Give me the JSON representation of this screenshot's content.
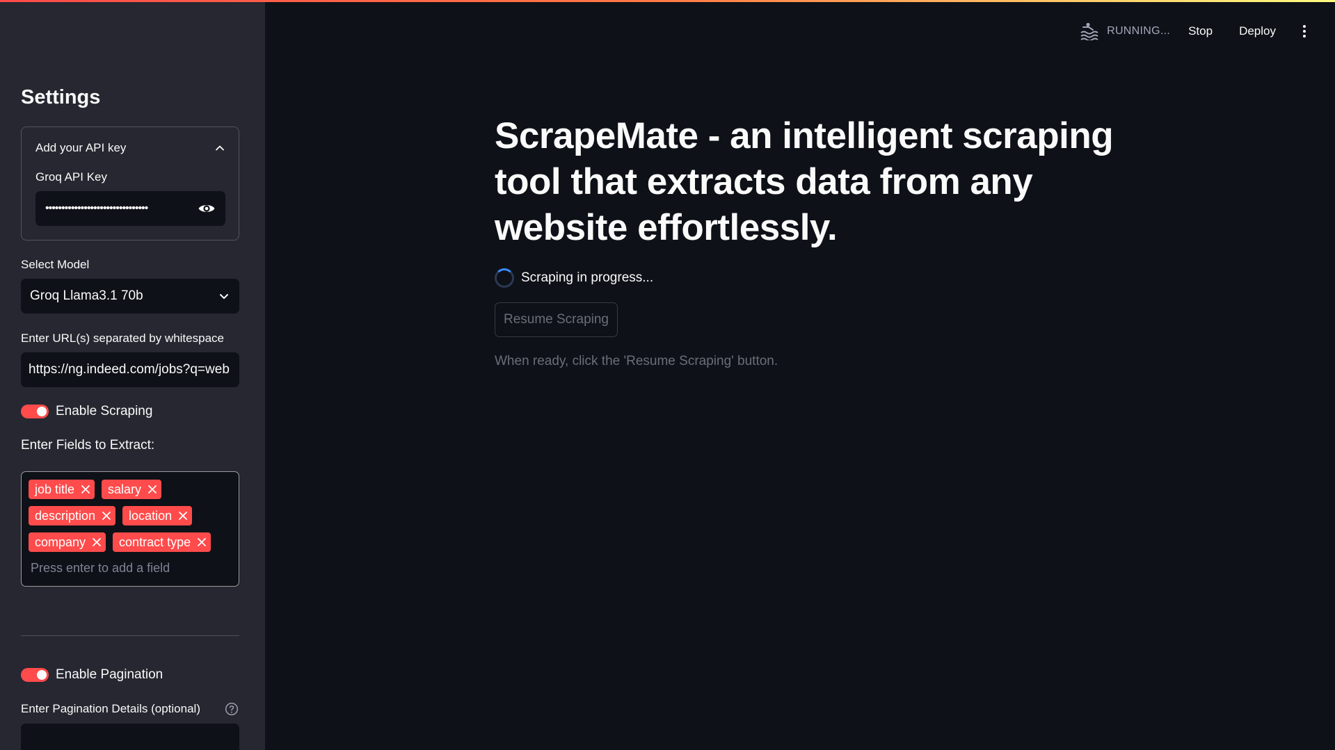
{
  "sidebar": {
    "title": "Settings",
    "api_expander": {
      "header": "Add your API key",
      "field_label": "Groq API Key",
      "masked_value": "••••••••••••••••••••••••••••••••"
    },
    "model": {
      "label": "Select Model",
      "selected": "Groq Llama3.1 70b"
    },
    "urls": {
      "label": "Enter URL(s) separated by whitespace",
      "value": "https://ng.indeed.com/jobs?q=web"
    },
    "enable_scraping": {
      "label": "Enable Scraping",
      "on": true
    },
    "fields": {
      "label": "Enter Fields to Extract:",
      "tags": [
        "job title",
        "salary",
        "description",
        "location",
        "company",
        "contract type"
      ],
      "placeholder": "Press enter to add a field"
    },
    "enable_pagination": {
      "label": "Enable Pagination",
      "on": true
    },
    "pagination_details": {
      "label": "Enter Pagination Details (optional)"
    }
  },
  "toolbar": {
    "status": "RUNNING...",
    "stop_label": "Stop",
    "deploy_label": "Deploy"
  },
  "main": {
    "headline": "ScrapeMate - an intelligent scraping tool that extracts data from any website effortlessly.",
    "status_text": "Scraping in progress...",
    "resume_label": "Resume Scraping",
    "hint": "When ready, click the 'Resume Scraping' button."
  },
  "colors": {
    "accent": "#ff4b4b",
    "background": "#0e1117",
    "sidebar": "#262730"
  }
}
